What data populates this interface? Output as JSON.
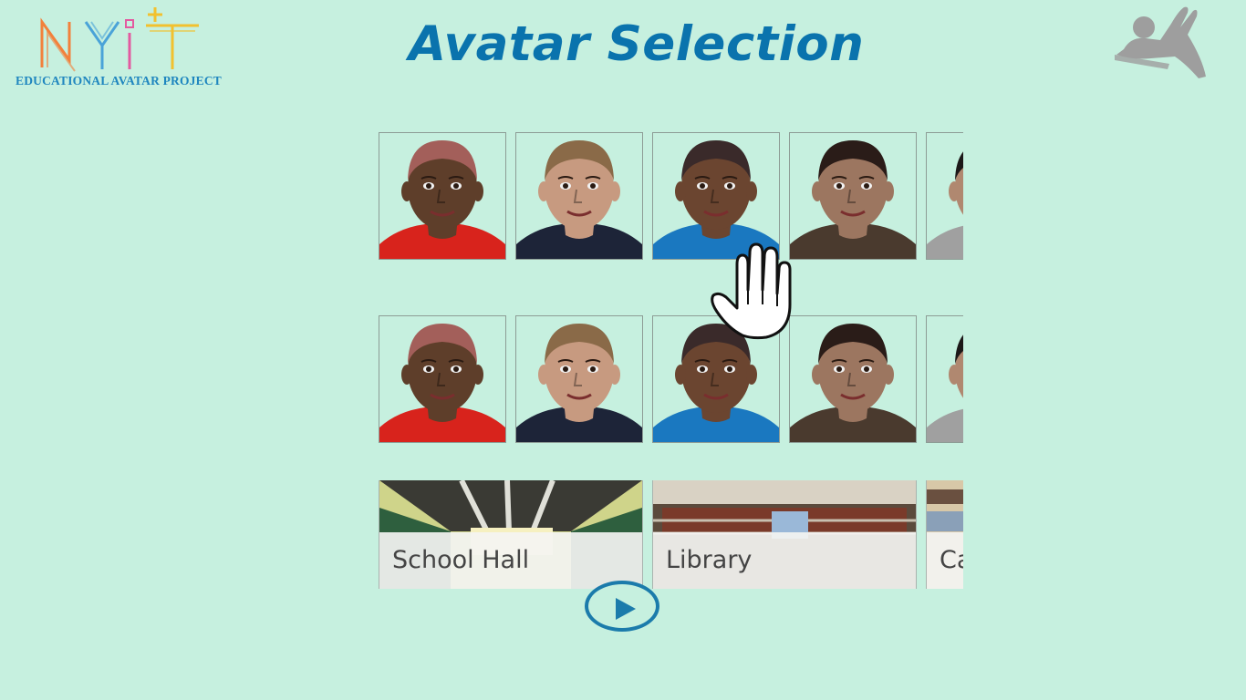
{
  "logo": {
    "mark": "NYiT",
    "subtitle": "EDUCATIONAL AVATAR PROJECT"
  },
  "header": {
    "title": "Avatar Selection",
    "gesture_icon": "pointing-person-icon"
  },
  "avatar_rows": [
    {
      "avatars": [
        {
          "name": "avatar-1",
          "skin": "#5e3e2a",
          "hair": "#a35f5a",
          "shirt": "#d8231c"
        },
        {
          "name": "avatar-2",
          "skin": "#c79a80",
          "hair": "#8a6a48",
          "shirt": "#1d2438"
        },
        {
          "name": "avatar-3",
          "skin": "#6b4530",
          "hair": "#3a2a2a",
          "shirt": "#1a78c0"
        },
        {
          "name": "avatar-4",
          "skin": "#9c7660",
          "hair": "#2a1c18",
          "shirt": "#4a3a2e"
        },
        {
          "name": "avatar-5",
          "skin": "#b08870",
          "hair": "#1c1818",
          "shirt": "#a0a0a0"
        }
      ]
    },
    {
      "avatars": [
        {
          "name": "avatar-1",
          "skin": "#5e3e2a",
          "hair": "#a35f5a",
          "shirt": "#d8231c"
        },
        {
          "name": "avatar-2",
          "skin": "#c79a80",
          "hair": "#8a6a48",
          "shirt": "#1d2438"
        },
        {
          "name": "avatar-3",
          "skin": "#6b4530",
          "hair": "#3a2a2a",
          "shirt": "#1a78c0"
        },
        {
          "name": "avatar-4",
          "skin": "#9c7660",
          "hair": "#2a1c18",
          "shirt": "#4a3a2e"
        },
        {
          "name": "avatar-5",
          "skin": "#b08870",
          "hair": "#1c1818",
          "shirt": "#a0a0a0"
        }
      ]
    }
  ],
  "scenes": [
    {
      "label": "School Hall"
    },
    {
      "label": "Library"
    },
    {
      "label": "Ca"
    }
  ],
  "play_icon": "play-icon",
  "cursor_icon": "hand-cursor-icon",
  "colors": {
    "background": "#c6f0df",
    "title": "#0a73ad",
    "accent": "#1b7bab"
  }
}
